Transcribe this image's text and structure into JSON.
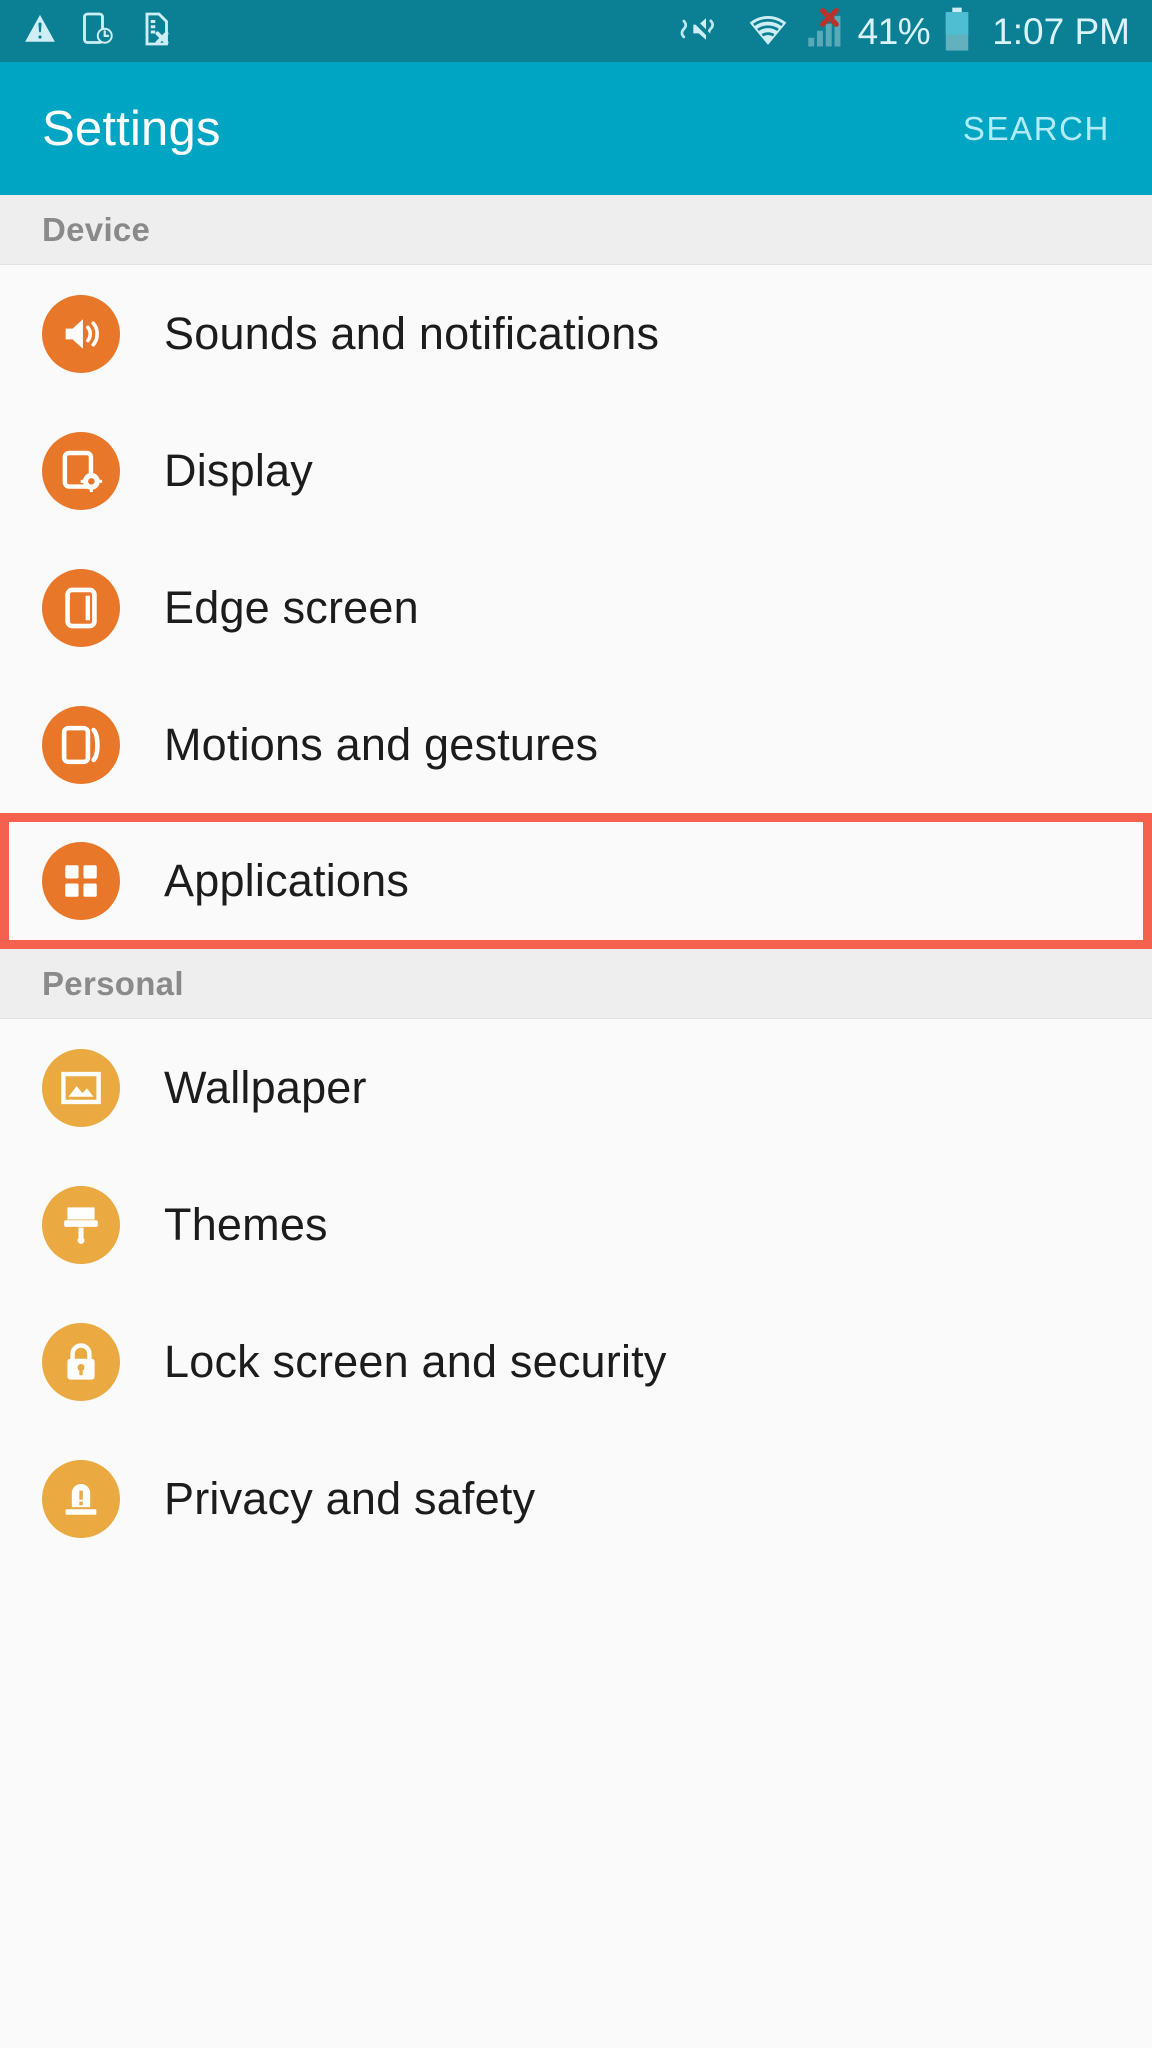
{
  "status_bar": {
    "icons_left": [
      "warning-triangle-icon",
      "device-clock-icon",
      "sim-card-error-icon"
    ],
    "icons_right": [
      "vibrate-mute-icon",
      "wifi-icon",
      "cell-signal-off-icon",
      "battery-icon"
    ],
    "battery_percent": "41%",
    "battery_level": 41,
    "time": "1:07 PM"
  },
  "app_bar": {
    "title": "Settings",
    "search_label": "SEARCH"
  },
  "sections": [
    {
      "header": "Device",
      "items": [
        {
          "label": "Sounds and notifications",
          "icon": "sound-icon",
          "color": "#e8772a",
          "highlighted": false
        },
        {
          "label": "Display",
          "icon": "display-icon",
          "color": "#e8772a",
          "highlighted": false
        },
        {
          "label": "Edge screen",
          "icon": "edge-screen-icon",
          "color": "#e8772a",
          "highlighted": false
        },
        {
          "label": "Motions and gestures",
          "icon": "motions-gestures-icon",
          "color": "#e8772a",
          "highlighted": false
        },
        {
          "label": "Applications",
          "icon": "applications-grid-icon",
          "color": "#e8772a",
          "highlighted": true
        }
      ]
    },
    {
      "header": "Personal",
      "items": [
        {
          "label": "Wallpaper",
          "icon": "wallpaper-image-icon",
          "color": "#eaa941",
          "highlighted": false
        },
        {
          "label": "Themes",
          "icon": "themes-brush-icon",
          "color": "#eaa941",
          "highlighted": false
        },
        {
          "label": "Lock screen and security",
          "icon": "lock-icon",
          "color": "#eaa941",
          "highlighted": false
        },
        {
          "label": "Privacy and safety",
          "icon": "privacy-alert-icon",
          "color": "#eaa941",
          "highlighted": false
        }
      ]
    }
  ],
  "colors": {
    "status_bar_bg": "#0b7f94",
    "app_bar_bg": "#00a5c4",
    "accent_orange": "#e8772a",
    "accent_amber": "#eaa941",
    "highlight_border": "#f4624f",
    "section_bg": "#eeeeee",
    "list_bg": "#fafafa"
  }
}
